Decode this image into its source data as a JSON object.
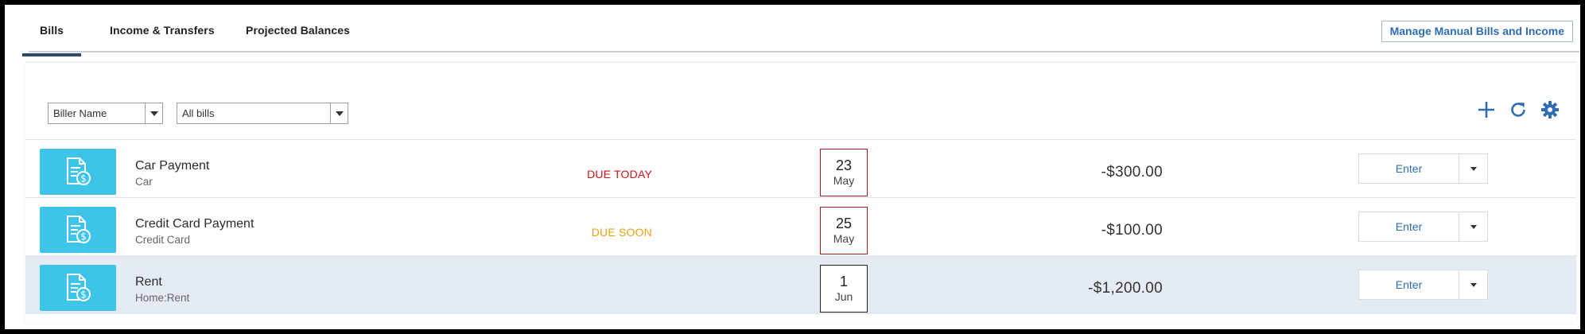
{
  "tabs": [
    {
      "label": "Bills",
      "active": true
    },
    {
      "label": "Income & Transfers",
      "active": false
    },
    {
      "label": "Projected Balances",
      "active": false
    }
  ],
  "manage_button": "Manage Manual Bills and Income",
  "filters": {
    "sort": {
      "selected": "Biller Name"
    },
    "scope": {
      "selected": "All bills"
    }
  },
  "toolbar": {
    "add_icon": "plus-icon",
    "refresh_icon": "refresh-icon",
    "settings_icon": "gear-icon",
    "icon_color": "#2f6db0"
  },
  "bills": [
    {
      "name": "Car Payment",
      "category": "Car",
      "status": "DUE TODAY",
      "status_color": "#c8151b",
      "day": "23",
      "month": "May",
      "amount": "-$300.00",
      "action": "Enter"
    },
    {
      "name": "Credit Card Payment",
      "category": "Credit Card",
      "status": "DUE SOON",
      "status_color": "#e6a21a",
      "day": "25",
      "month": "May",
      "amount": "-$100.00",
      "action": "Enter"
    },
    {
      "name": "Rent",
      "category": "Home:Rent",
      "status": "",
      "status_color": "",
      "day": "1",
      "month": "Jun",
      "amount": "-$1,200.00",
      "action": "Enter"
    }
  ],
  "colors": {
    "bill_icon_bg": "#3ec4e8",
    "highlight_row": "#e5ebf3",
    "tab_underline": "#2a4a6b"
  }
}
